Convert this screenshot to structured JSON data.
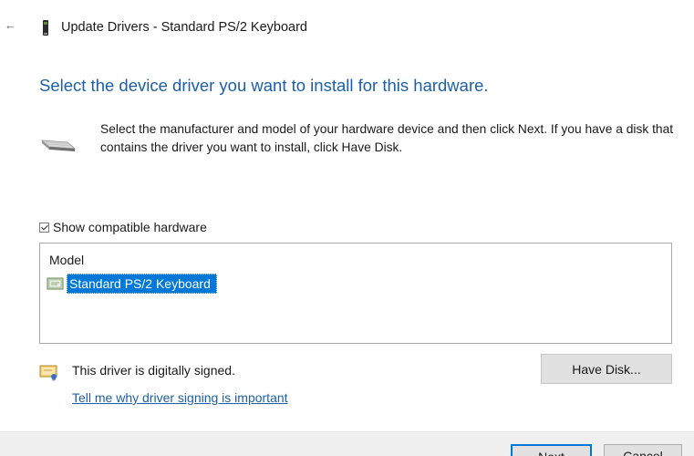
{
  "window": {
    "back_icon": "back-arrow-icon",
    "title_icon": "keyboard-device-icon",
    "title": "Update Drivers - Standard PS/2 Keyboard"
  },
  "main": {
    "heading": "Select the device driver you want to install for this hardware.",
    "device_icon": "hardware-device-icon",
    "instruction": "Select the manufacturer and model of your hardware device and then click Next. If you have a disk that contains the driver you want to install, click Have Disk.",
    "show_compatible": {
      "label": "Show compatible hardware",
      "checked": true
    },
    "model_list": {
      "header": "Model",
      "items": [
        {
          "label": "Standard PS/2 Keyboard",
          "icon": "driver-certificate-icon",
          "selected": true
        }
      ]
    },
    "signed": {
      "icon": "signed-certificate-icon",
      "text": "This driver is digitally signed.",
      "link": "Tell me why driver signing is important"
    },
    "have_disk_label": "Have Disk..."
  },
  "footer": {
    "next_label": "Next",
    "cancel_label": "Cancel"
  },
  "colors": {
    "heading": "#1c5fa8",
    "selection": "#0078d7",
    "link": "#1c5fa8",
    "button_face": "#e1e1e1"
  }
}
